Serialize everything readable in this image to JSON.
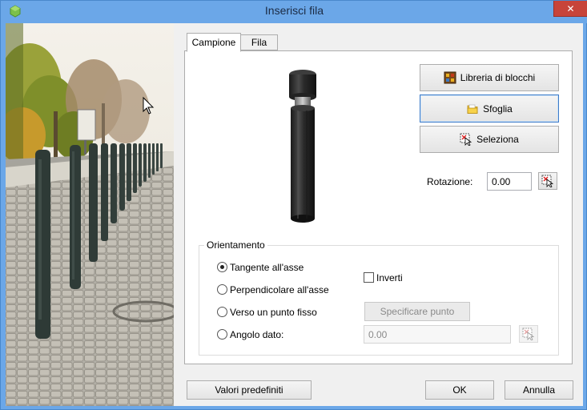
{
  "window": {
    "title": "Inserisci fila",
    "close_glyph": "✕"
  },
  "tabs": [
    {
      "label": "Campione",
      "active": true
    },
    {
      "label": "Fila",
      "active": false
    }
  ],
  "block_buttons": {
    "library": {
      "label": "Libreria di blocchi",
      "icon": "block-library-icon"
    },
    "browse": {
      "label": "Sfoglia",
      "icon": "folder-icon"
    },
    "select": {
      "label": "Seleziona",
      "icon": "select-pick-icon"
    }
  },
  "rotation": {
    "label": "Rotazione:",
    "value": "0.00"
  },
  "orientation": {
    "title": "Orientamento",
    "options": [
      {
        "label": "Tangente all'asse",
        "checked": true
      },
      {
        "label": "Perpendicolare all'asse",
        "checked": false
      },
      {
        "label": "Verso un punto fisso",
        "checked": false
      },
      {
        "label": "Angolo dato:",
        "checked": false
      }
    ],
    "invert_label": "Inverti",
    "invert_checked": false,
    "specify_point_label": "Specificare punto",
    "angle_value": "0.00"
  },
  "footer": {
    "defaults_label": "Valori predefiniti",
    "ok_label": "OK",
    "cancel_label": "Annulla"
  }
}
